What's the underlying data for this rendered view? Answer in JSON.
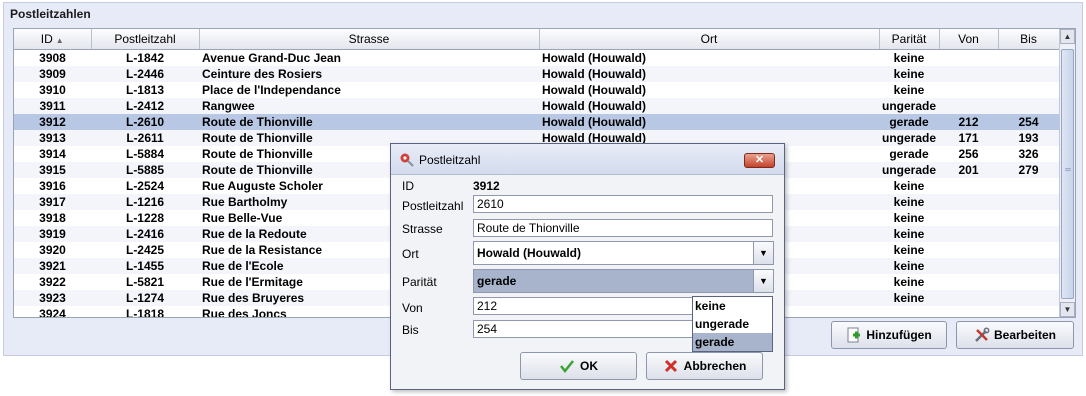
{
  "panel": {
    "title": "Postleitzahlen"
  },
  "table": {
    "columns": [
      "ID",
      "Postleitzahl",
      "Strasse",
      "Ort",
      "Parität",
      "Von",
      "Bis"
    ],
    "sort_indicator": "▲",
    "rows": [
      {
        "id": "3908",
        "plz": "L-1842",
        "strasse": "Avenue Grand-Duc Jean",
        "ort": "Howald (Houwald)",
        "paritaet": "keine",
        "von": "",
        "bis": ""
      },
      {
        "id": "3909",
        "plz": "L-2446",
        "strasse": "Ceinture des Rosiers",
        "ort": "Howald (Houwald)",
        "paritaet": "keine",
        "von": "",
        "bis": ""
      },
      {
        "id": "3910",
        "plz": "L-1813",
        "strasse": "Place de l'Independance",
        "ort": "Howald (Houwald)",
        "paritaet": "keine",
        "von": "",
        "bis": ""
      },
      {
        "id": "3911",
        "plz": "L-2412",
        "strasse": "Rangwee",
        "ort": "Howald (Houwald)",
        "paritaet": "ungerade",
        "von": "",
        "bis": ""
      },
      {
        "id": "3912",
        "plz": "L-2610",
        "strasse": "Route de Thionville",
        "ort": "Howald (Houwald)",
        "paritaet": "gerade",
        "von": "212",
        "bis": "254"
      },
      {
        "id": "3913",
        "plz": "L-2611",
        "strasse": "Route de Thionville",
        "ort": "Howald (Houwald)",
        "paritaet": "ungerade",
        "von": "171",
        "bis": "193"
      },
      {
        "id": "3914",
        "plz": "L-5884",
        "strasse": "Route de Thionville",
        "ort": "",
        "paritaet": "gerade",
        "von": "256",
        "bis": "326"
      },
      {
        "id": "3915",
        "plz": "L-5885",
        "strasse": "Route de Thionville",
        "ort": "",
        "paritaet": "ungerade",
        "von": "201",
        "bis": "279"
      },
      {
        "id": "3916",
        "plz": "L-2524",
        "strasse": "Rue Auguste Scholer",
        "ort": "",
        "paritaet": "keine",
        "von": "",
        "bis": ""
      },
      {
        "id": "3917",
        "plz": "L-1216",
        "strasse": "Rue Bartholmy",
        "ort": "",
        "paritaet": "keine",
        "von": "",
        "bis": ""
      },
      {
        "id": "3918",
        "plz": "L-1228",
        "strasse": "Rue Belle-Vue",
        "ort": "",
        "paritaet": "keine",
        "von": "",
        "bis": ""
      },
      {
        "id": "3919",
        "plz": "L-2416",
        "strasse": "Rue de la Redoute",
        "ort": "",
        "paritaet": "keine",
        "von": "",
        "bis": ""
      },
      {
        "id": "3920",
        "plz": "L-2425",
        "strasse": "Rue de la Resistance",
        "ort": "",
        "paritaet": "keine",
        "von": "",
        "bis": ""
      },
      {
        "id": "3921",
        "plz": "L-1455",
        "strasse": "Rue de l'Ecole",
        "ort": "",
        "paritaet": "keine",
        "von": "",
        "bis": ""
      },
      {
        "id": "3922",
        "plz": "L-5821",
        "strasse": "Rue de l'Ermitage",
        "ort": "",
        "paritaet": "keine",
        "von": "",
        "bis": ""
      },
      {
        "id": "3923",
        "plz": "L-1274",
        "strasse": "Rue des Bruyeres",
        "ort": "",
        "paritaet": "keine",
        "von": "",
        "bis": ""
      },
      {
        "id": "3924",
        "plz": "L-1818",
        "strasse": "Rue des Joncs",
        "ort": "",
        "paritaet": "",
        "von": "",
        "bis": ""
      }
    ],
    "selected_id": "3912"
  },
  "buttons": {
    "add": "Hinzufügen",
    "edit": "Bearbeiten"
  },
  "dialog": {
    "title": "Postleitzahl",
    "close": "✕",
    "labels": {
      "id": "ID",
      "plz": "Postleitzahl",
      "strasse": "Strasse",
      "ort": "Ort",
      "paritaet": "Parität",
      "von": "Von",
      "bis": "Bis"
    },
    "values": {
      "id": "3912",
      "plz": "2610",
      "strasse": "Route de Thionville",
      "ort": "Howald (Houwald)",
      "paritaet": "gerade",
      "von": "212",
      "bis": "254"
    },
    "paritaet_options": [
      "keine",
      "ungerade",
      "gerade"
    ],
    "ok": "OK",
    "cancel": "Abbrechen"
  },
  "colors": {
    "selection": "#b8c8e4",
    "panel_bg": "#e7eaf7",
    "dropdown_selection": "#a7b4cc"
  }
}
